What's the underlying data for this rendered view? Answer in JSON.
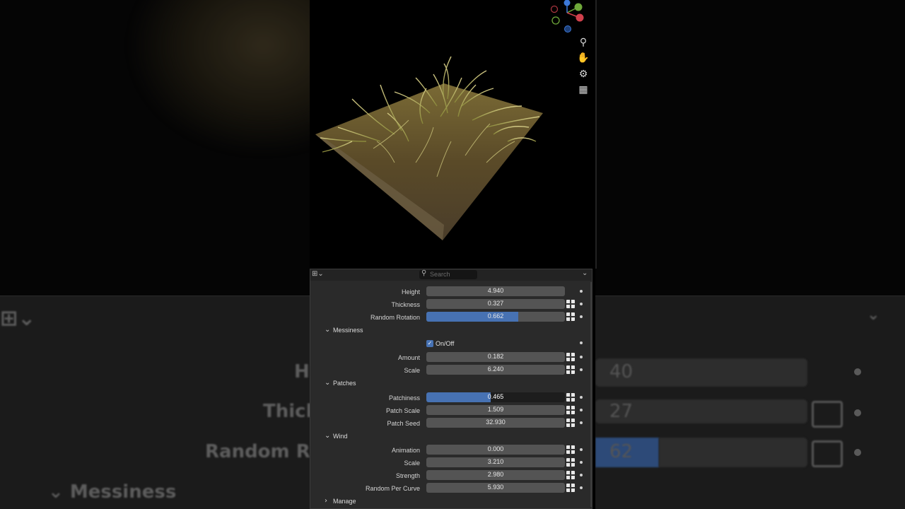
{
  "header": {
    "editor_type_icon": "editor-type-icon",
    "search_placeholder": "Search",
    "collapse_icon": "chevron-down-icon"
  },
  "rows_top": [
    {
      "label": "Height",
      "value": "4.940",
      "fill": 0,
      "driver": false
    },
    {
      "label": "Thickness",
      "value": "0.327",
      "fill": 0,
      "driver": true
    },
    {
      "label": "Random Rotation",
      "value": "0.662",
      "fill": 0.662,
      "driver": true
    }
  ],
  "messiness": {
    "title": "Messiness",
    "toggle_label": "On/Off",
    "toggle_checked": true,
    "rows": [
      {
        "label": "Amount",
        "value": "0.182"
      },
      {
        "label": "Scale",
        "value": "6.240"
      }
    ]
  },
  "patches": {
    "title": "Patches",
    "rows": [
      {
        "label": "Patchiness",
        "value": "0.465",
        "fill": 0.465
      },
      {
        "label": "Patch Scale",
        "value": "1.509"
      },
      {
        "label": "Patch Seed",
        "value": "32.930"
      }
    ]
  },
  "wind": {
    "title": "Wind",
    "rows": [
      {
        "label": "Animation",
        "value": "0.000"
      },
      {
        "label": "Scale",
        "value": "3.210"
      },
      {
        "label": "Strength",
        "value": "2.980"
      },
      {
        "label": "Random Per Curve",
        "value": "5.930"
      }
    ]
  },
  "manage": {
    "title": "Manage"
  },
  "background_ghost": {
    "labels": [
      "H",
      "Thick",
      "Random Rot",
      "Messiness"
    ],
    "values": [
      "40",
      "27",
      "62"
    ]
  },
  "colors": {
    "accent": "#4772b3",
    "panel_bg": "#2a2a2a",
    "field_bg": "#545454"
  }
}
